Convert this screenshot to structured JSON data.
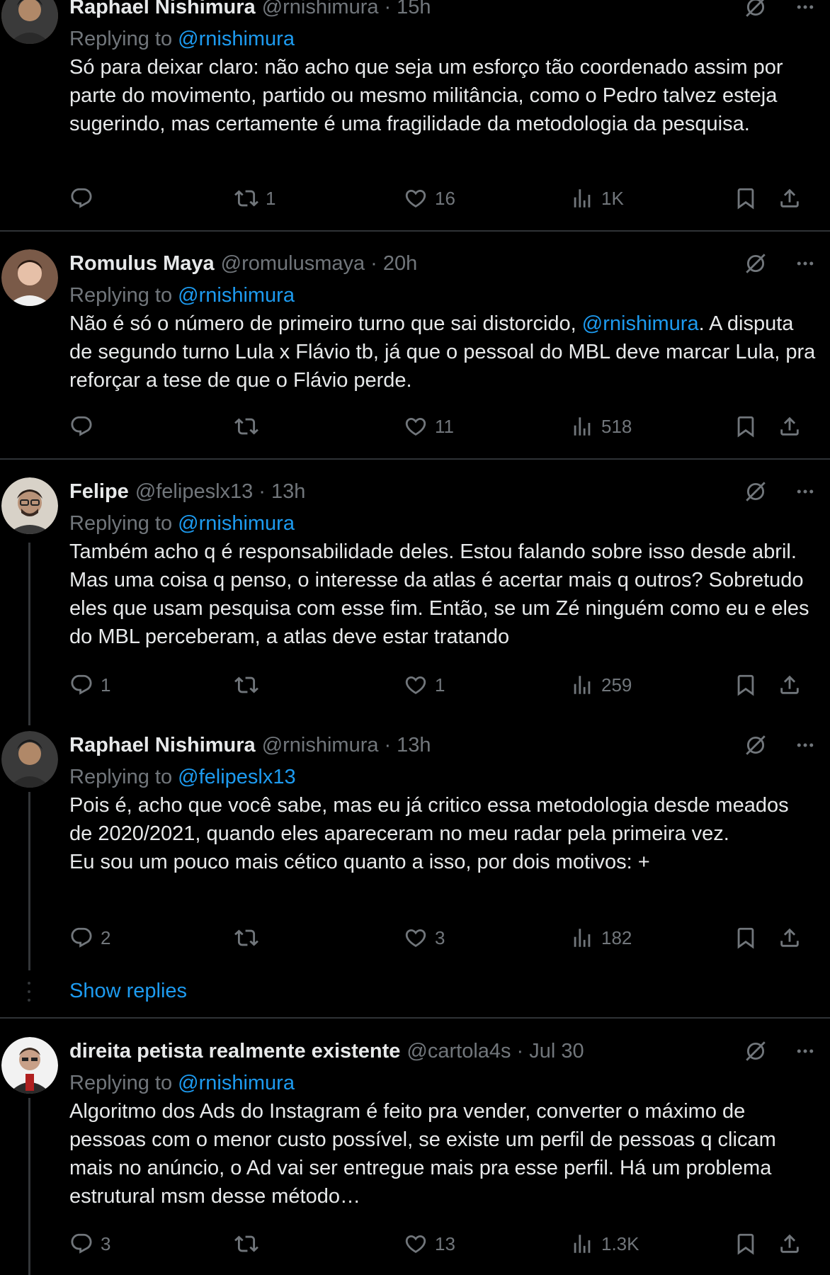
{
  "tweets": [
    {
      "name": "Raphael Nishimura",
      "handle": "@rnishimura",
      "time": "15h",
      "replying_prefix": "Replying to",
      "replying_to": "@rnishimura",
      "text": "Só para deixar claro: não acho que seja um esforço tão coordenado assim por parte do movimento, partido ou mesmo militância, como o Pedro talvez esteja sugerindo, mas certamente é uma fragilidade da metodologia da pesquisa.",
      "replies": "",
      "reposts": "1",
      "likes": "16",
      "views": "1K",
      "avatar_color": "#5a4a3a"
    },
    {
      "name": "Romulus Maya",
      "handle": "@romulusmaya",
      "time": "20h",
      "replying_prefix": "Replying to",
      "replying_to": "@rnishimura",
      "text_before": "Não é só o número de primeiro turno que sai distorcido, ",
      "text_mention": "@rnishimura",
      "text_after": ". A disputa de segundo turno Lula x Flávio tb, já que o pessoal do MBL deve marcar Lula, pra reforçar a tese de que o Flávio perde.",
      "replies": "",
      "reposts": "",
      "likes": "11",
      "views": "518",
      "avatar_color": "#c9a48a"
    },
    {
      "name": "Felipe",
      "handle": "@felipeslx13",
      "time": "13h",
      "replying_prefix": "Replying to",
      "replying_to": "@rnishimura",
      "text": "Também acho q é responsabilidade deles. Estou falando sobre isso desde abril. Mas uma coisa q penso, o interesse da atlas é acertar mais q outros? Sobretudo eles que usam pesquisa com esse fim. Então, se um Zé ninguém como eu e eles do MBL perceberam, a atlas deve estar tratando",
      "replies": "1",
      "reposts": "",
      "likes": "1",
      "views": "259",
      "avatar_color": "#8a7060"
    },
    {
      "name": "Raphael Nishimura",
      "handle": "@rnishimura",
      "time": "13h",
      "replying_prefix": "Replying to",
      "replying_to": "@felipeslx13",
      "text": "Pois é, acho que você sabe, mas eu já critico essa metodologia desde meados de 2020/2021, quando eles apareceram no meu radar pela primeira vez.\nEu sou um pouco mais cético quanto a isso, por dois motivos: +",
      "replies": "2",
      "reposts": "",
      "likes": "3",
      "views": "182",
      "avatar_color": "#5a4a3a"
    },
    {
      "name": "direita petista realmente existente",
      "handle": "@cartola4s",
      "time": "Jul 30",
      "replying_prefix": "Replying to",
      "replying_to": "@rnishimura",
      "text": "Algoritmo dos Ads do Instagram é feito pra vender, converter o máximo de pessoas com o menor custo possível, se existe um perfil de pessoas q clicam mais no anúncio, o Ad vai ser entregue mais pra esse perfil. Há um problema estrutural msm desse método…",
      "replies": "3",
      "reposts": "",
      "likes": "13",
      "views": "1.3K",
      "avatar_color": "#d0d0d0"
    }
  ],
  "show_replies": "Show replies",
  "separator": "·"
}
